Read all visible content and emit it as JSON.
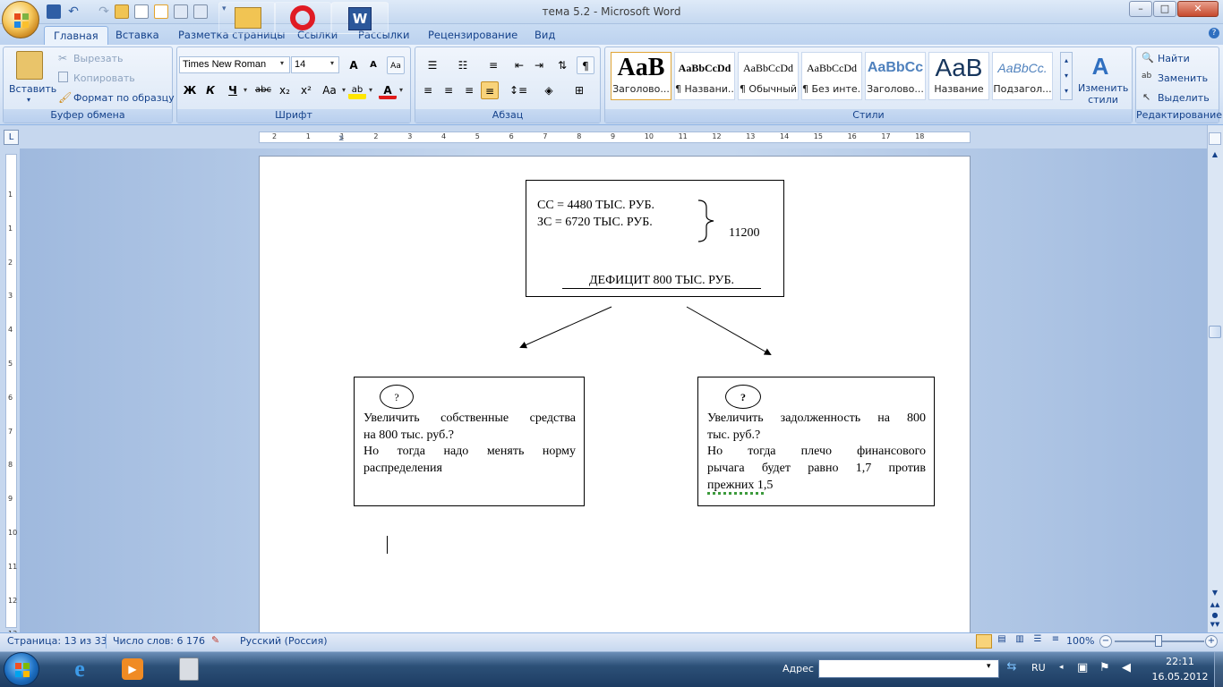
{
  "window": {
    "title": "тема 5.2 - Microsoft Word",
    "minimize": "–",
    "maximize": "□",
    "close": "✕"
  },
  "tabs": [
    "Главная",
    "Вставка",
    "Разметка страницы",
    "Ссылки",
    "Рассылки",
    "Рецензирование",
    "Вид"
  ],
  "clipboard": {
    "paste": "Вставить",
    "cut": "Вырезать",
    "copy": "Копировать",
    "format_painter": "Формат по образцу",
    "group": "Буфер обмена"
  },
  "font": {
    "name": "Times New Roman",
    "size": "14",
    "grow": "A",
    "shrink": "A",
    "bold": "Ж",
    "italic": "К",
    "underline": "Ч",
    "strike": "abc",
    "sub": "x₂",
    "sup": "x²",
    "case": "Aa",
    "highlight": "ab",
    "color": "A",
    "group": "Шрифт"
  },
  "paragraph": {
    "group": "Абзац"
  },
  "styles": {
    "items": [
      {
        "preview": "AaB",
        "name": "Заголово..."
      },
      {
        "preview": "AaBbCcDd",
        "name": "¶ Названи..."
      },
      {
        "preview": "AaBbCcDd",
        "name": "¶ Обычный"
      },
      {
        "preview": "AaBbCcDd",
        "name": "¶ Без инте..."
      },
      {
        "preview": "AaBbCc",
        "name": "Заголово..."
      },
      {
        "preview": "AaB",
        "name": "Название"
      },
      {
        "preview": "AaBbCc.",
        "name": "Подзагол..."
      }
    ],
    "change": "Изменить стили",
    "group": "Стили"
  },
  "editing": {
    "find": "Найти",
    "replace": "Заменить",
    "select": "Выделить",
    "group": "Редактирование"
  },
  "ruler": {
    "numbers": [
      "2",
      "1",
      "1",
      "2",
      "3",
      "4",
      "5",
      "6",
      "7",
      "8",
      "9",
      "10",
      "11",
      "12",
      "13",
      "14",
      "15",
      "16",
      "17",
      "18"
    ],
    "vnumbers": [
      "1",
      "1",
      "2",
      "3",
      "4",
      "5",
      "6",
      "7",
      "8",
      "9",
      "10",
      "11",
      "12",
      "13"
    ]
  },
  "doc": {
    "top": {
      "line1": "СС = 4480 ТЫС. РУБ.",
      "line2": "ЗС = 6720 ТЫС. РУБ.",
      "sum": "11200",
      "deficit": "ДЕФИЦИТ  800 ТЫС.  РУБ."
    },
    "left": {
      "q": "?",
      "lines": [
        "Увеличить собственные средства",
        "на 800 тыс. руб.?",
        "Но тогда надо менять норму",
        "распределения"
      ]
    },
    "right": {
      "q": "?",
      "lines": [
        "Увеличить задолженность на 800",
        "тыс. руб.?",
        "Но тогда плечо финансового",
        "рычага будет равно 1,7 против",
        "прежних 1,5"
      ]
    }
  },
  "status": {
    "page": "Страница: 13 из 33",
    "words": "Число слов: 6 176",
    "lang": "Русский (Россия)",
    "zoom": "100%"
  },
  "taskbar": {
    "address_label": "Адрес",
    "lang": "RU",
    "time": "22:11",
    "date": "16.05.2012"
  }
}
